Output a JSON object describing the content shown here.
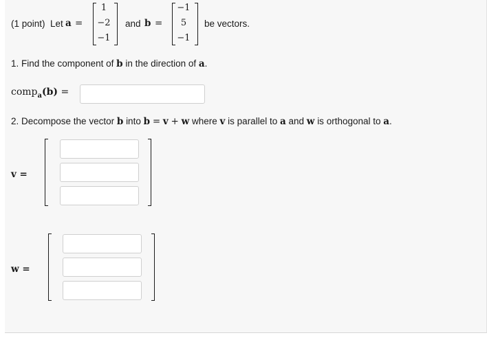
{
  "problem": {
    "points": "(1 point)",
    "intro_let": "Let",
    "vec_a_name": "a",
    "equals": "=",
    "vec_a": [
      "1",
      "−2",
      "−1"
    ],
    "and": "and",
    "vec_b_name": "b",
    "vec_b": [
      "−1",
      "5",
      "−1"
    ],
    "be_vectors": "be vectors."
  },
  "part1": {
    "prefix": "1. Find the component of",
    "b": "b",
    "middle": "in the direction of",
    "a": "a",
    "end": ".",
    "comp_label": "comp",
    "comp_sub": "a",
    "comp_arg": "(b)",
    "equals": "=",
    "answer_value": ""
  },
  "part2": {
    "prefix": "2. Decompose the vector",
    "b1": "b",
    "into": "into",
    "b2": "b",
    "eq": "=",
    "v": "v",
    "plus": "+",
    "w": "w",
    "where": "where",
    "v2": "v",
    "parallel": "is parallel to",
    "a1": "a",
    "and_text": "and",
    "w2": "w",
    "orth": "is orthogonal to",
    "a2": "a",
    "end": ".",
    "v_label": "v =",
    "w_label": "w =",
    "v_values": [
      "",
      "",
      ""
    ],
    "w_values": [
      "",
      "",
      ""
    ]
  }
}
